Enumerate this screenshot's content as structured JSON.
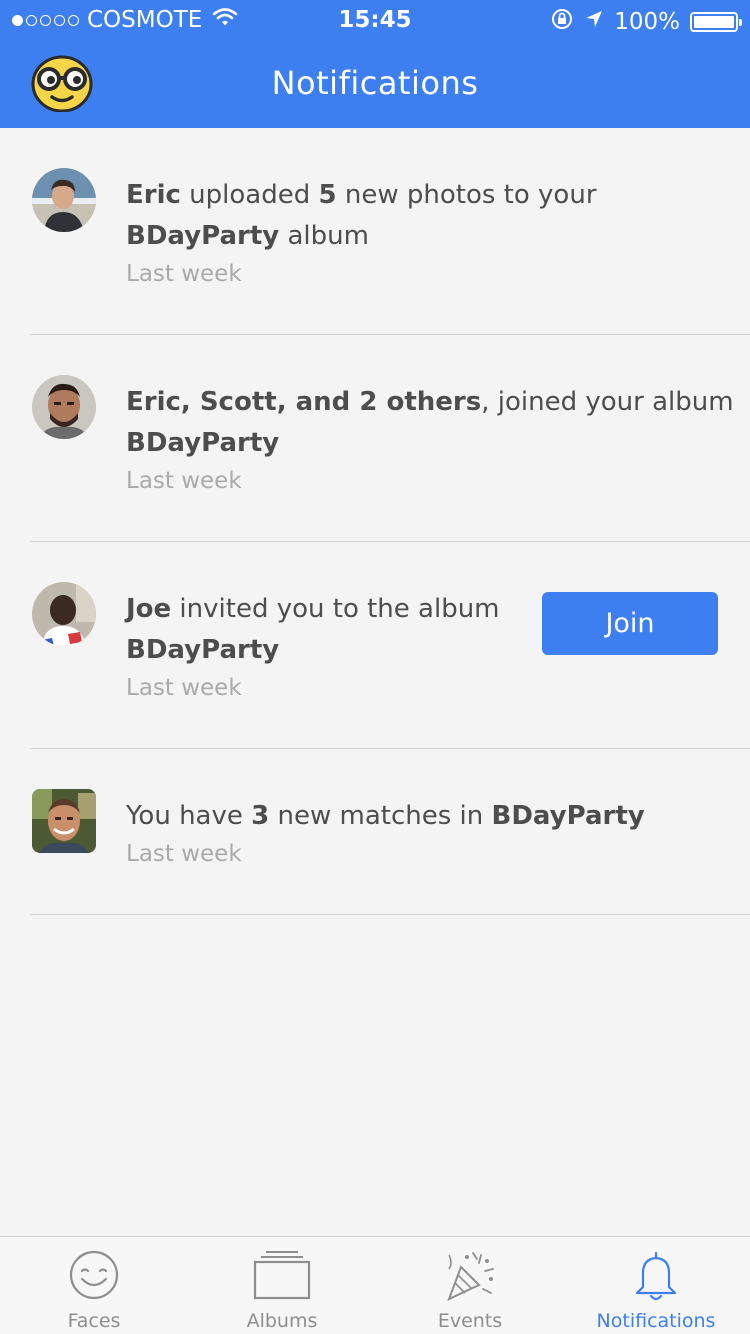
{
  "status_bar": {
    "carrier": "COSMOTE",
    "time": "15:45",
    "battery": "100%"
  },
  "header": {
    "title": "Notifications"
  },
  "notifications": [
    {
      "parts": [
        {
          "text": "Eric",
          "bold": true
        },
        {
          "text": " uploaded ",
          "bold": false
        },
        {
          "text": "5",
          "bold": true
        },
        {
          "text": " new photos to your",
          "bold": false
        }
      ],
      "line2": [
        {
          "text": "BDayParty",
          "bold": true
        },
        {
          "text": " album",
          "bold": false
        }
      ],
      "time": "Last week"
    },
    {
      "parts": [
        {
          "text": "Eric, Scott, and 2 others",
          "bold": true
        },
        {
          "text": ", joined your album",
          "bold": false
        }
      ],
      "line2": [
        {
          "text": "BDayParty",
          "bold": true
        }
      ],
      "time": "Last week"
    },
    {
      "parts": [
        {
          "text": "Joe",
          "bold": true
        },
        {
          "text": " invited you to the album",
          "bold": false
        }
      ],
      "line2": [
        {
          "text": "BDayParty",
          "bold": true
        }
      ],
      "time": "Last week",
      "action_label": "Join"
    },
    {
      "parts": [
        {
          "text": "You have ",
          "bold": false
        },
        {
          "text": "3",
          "bold": true
        },
        {
          "text": " new matches in ",
          "bold": false
        },
        {
          "text": "BDayParty",
          "bold": true
        }
      ],
      "time": "Last week"
    }
  ],
  "tabbar": {
    "tabs": [
      {
        "label": "Faces",
        "icon": "smiley-icon",
        "active": false
      },
      {
        "label": "Albums",
        "icon": "albums-icon",
        "active": false
      },
      {
        "label": "Events",
        "icon": "party-popper-icon",
        "active": false
      },
      {
        "label": "Notifications",
        "icon": "bell-icon",
        "active": true
      }
    ]
  },
  "colors": {
    "accent": "#3d7ff0",
    "background": "#f4f4f4",
    "muted_text": "#aaaaaa"
  }
}
